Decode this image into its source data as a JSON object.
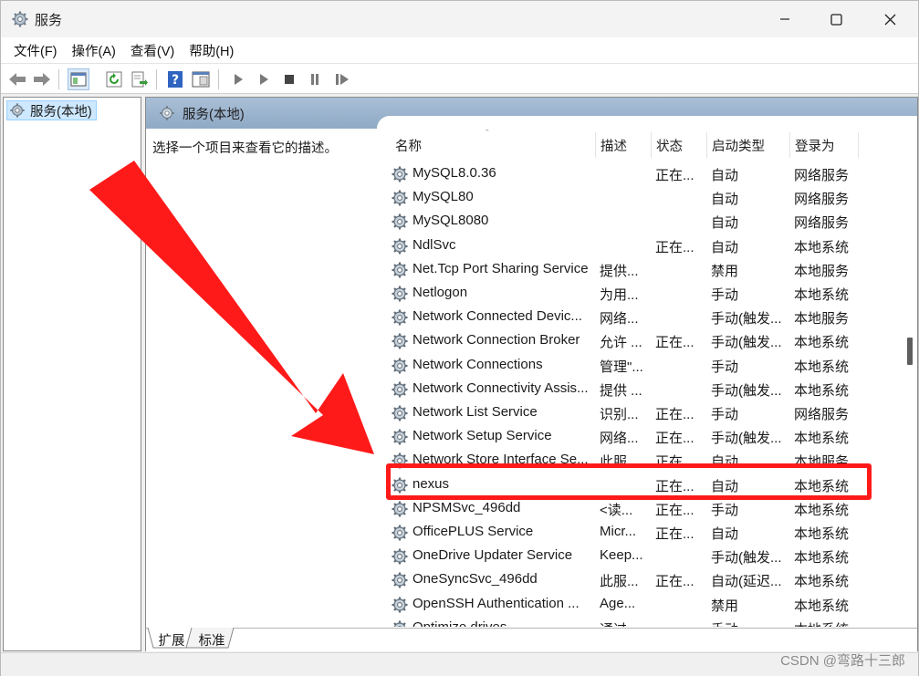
{
  "window": {
    "title": "服务",
    "controls": {
      "minimize": "minimize-icon",
      "maximize": "maximize-icon",
      "close": "close-icon"
    }
  },
  "menu": [
    "文件(F)",
    "操作(A)",
    "查看(V)",
    "帮助(H)"
  ],
  "toolbar_icons": [
    "back-arrow-icon",
    "forward-arrow-icon",
    "show-hide-console-tree-icon",
    "refresh-icon",
    "export-list-icon",
    "help-icon",
    "properties-icon",
    "start-service-icon",
    "start-service-alt-icon",
    "stop-service-icon",
    "pause-service-icon",
    "resume-service-icon"
  ],
  "tree": {
    "root_label": "服务(本地)"
  },
  "pane": {
    "header": "服务(本地)",
    "description": "选择一个项目来查看它的描述。",
    "columns": [
      "名称",
      "描述",
      "状态",
      "启动类型",
      "登录为"
    ],
    "sort_indicator": "ˆ"
  },
  "services": [
    {
      "name": "MySQL8.0.36",
      "desc": "",
      "status": "正在...",
      "startup": "自动",
      "logon": "网络服务"
    },
    {
      "name": "MySQL80",
      "desc": "",
      "status": "",
      "startup": "自动",
      "logon": "网络服务"
    },
    {
      "name": "MySQL8080",
      "desc": "",
      "status": "",
      "startup": "自动",
      "logon": "网络服务"
    },
    {
      "name": "NdlSvc",
      "desc": "",
      "status": "正在...",
      "startup": "自动",
      "logon": "本地系统"
    },
    {
      "name": "Net.Tcp Port Sharing Service",
      "desc": "提供...",
      "status": "",
      "startup": "禁用",
      "logon": "本地服务"
    },
    {
      "name": "Netlogon",
      "desc": "为用...",
      "status": "",
      "startup": "手动",
      "logon": "本地系统"
    },
    {
      "name": "Network Connected Devic...",
      "desc": "网络...",
      "status": "",
      "startup": "手动(触发...",
      "logon": "本地服务"
    },
    {
      "name": "Network Connection Broker",
      "desc": "允许 ...",
      "status": "正在...",
      "startup": "手动(触发...",
      "logon": "本地系统"
    },
    {
      "name": "Network Connections",
      "desc": "管理\"...",
      "status": "",
      "startup": "手动",
      "logon": "本地系统"
    },
    {
      "name": "Network Connectivity Assis...",
      "desc": "提供 ...",
      "status": "",
      "startup": "手动(触发...",
      "logon": "本地系统"
    },
    {
      "name": "Network List Service",
      "desc": "识别...",
      "status": "正在...",
      "startup": "手动",
      "logon": "网络服务"
    },
    {
      "name": "Network Setup Service",
      "desc": "网络...",
      "status": "正在...",
      "startup": "手动(触发...",
      "logon": "本地系统"
    },
    {
      "name": "Network Store Interface Se...",
      "desc": "此服...",
      "status": "正在...",
      "startup": "自动",
      "logon": "本地服务"
    },
    {
      "name": "nexus",
      "desc": "",
      "status": "正在...",
      "startup": "自动",
      "logon": "本地系统"
    },
    {
      "name": "NPSMSvc_496dd",
      "desc": "<读...",
      "status": "正在...",
      "startup": "手动",
      "logon": "本地系统"
    },
    {
      "name": "OfficePLUS Service",
      "desc": "Micr...",
      "status": "正在...",
      "startup": "自动",
      "logon": "本地系统"
    },
    {
      "name": "OneDrive Updater Service",
      "desc": "Keep...",
      "status": "",
      "startup": "手动(触发...",
      "logon": "本地系统"
    },
    {
      "name": "OneSyncSvc_496dd",
      "desc": "此服...",
      "status": "正在...",
      "startup": "自动(延迟...",
      "logon": "本地系统"
    },
    {
      "name": "OpenSSH Authentication ...",
      "desc": "Age...",
      "status": "",
      "startup": "禁用",
      "logon": "本地系统"
    },
    {
      "name": "Optimize drives",
      "desc": "通过...",
      "status": "",
      "startup": "手动",
      "logon": "本地系统"
    }
  ],
  "highlighted_service": "nexus",
  "bottom_tabs": [
    "扩展",
    "标准"
  ],
  "watermark": "CSDN @弯路十三郎",
  "colors": {
    "annotation_red": "#ff1a1a",
    "header_blue": "#9bb3cd",
    "selection_blue": "#cde8ff"
  }
}
